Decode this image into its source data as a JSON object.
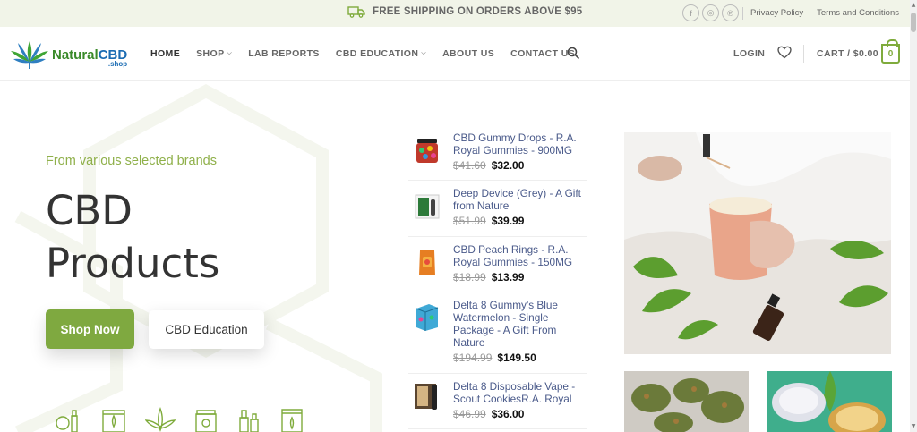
{
  "topbar": {
    "shipping_text": "FREE SHIPPING ON ORDERS ABOVE $95",
    "social": [
      {
        "icon": "facebook-icon",
        "glyph": "f"
      },
      {
        "icon": "instagram-icon",
        "glyph": "◎"
      },
      {
        "icon": "pinterest-icon",
        "glyph": "℗"
      }
    ],
    "links": [
      "Privacy Policy",
      "Terms and Conditions"
    ]
  },
  "header": {
    "logo": {
      "natural": "Natural",
      "cbd": "CBD",
      "shop": ".shop"
    },
    "nav": [
      {
        "label": "HOME",
        "active": true,
        "dropdown": false
      },
      {
        "label": "SHOP",
        "active": false,
        "dropdown": true
      },
      {
        "label": "LAB REPORTS",
        "active": false,
        "dropdown": false
      },
      {
        "label": "CBD EDUCATION",
        "active": false,
        "dropdown": true
      },
      {
        "label": "ABOUT US",
        "active": false,
        "dropdown": false
      },
      {
        "label": "CONTACT US",
        "active": false,
        "dropdown": false
      }
    ],
    "login_label": "LOGIN",
    "cart_label": "CART / $0.00",
    "cart_count": "0"
  },
  "hero": {
    "tagline": "From various selected brands",
    "title_line1": "CBD",
    "title_line2": "Products",
    "primary_button": "Shop Now",
    "secondary_button": "CBD Education"
  },
  "products": [
    {
      "name": "CBD Gummy Drops - R.A. Royal Gummies - 900MG",
      "old_price": "$41.60",
      "price": "$32.00",
      "thumb_color": "#c0392b"
    },
    {
      "name": "Deep Device (Grey) - A Gift from Nature",
      "old_price": "$51.99",
      "price": "$39.99",
      "thumb_color": "#444444"
    },
    {
      "name": "CBD Peach Rings - R.A. Royal Gummies - 150MG",
      "old_price": "$18.99",
      "price": "$13.99",
      "thumb_color": "#e67e22"
    },
    {
      "name": "Delta 8 Gummy's Blue Watermelon - Single Package - A Gift From Nature",
      "old_price": "$194.99",
      "price": "$149.50",
      "thumb_color": "#3fa9d6"
    },
    {
      "name": "Delta 8 Disposable Vape - Scout CookiesR.A. Royal",
      "old_price": "$46.99",
      "price": "$36.00",
      "thumb_color": "#5a4530"
    }
  ],
  "colors": {
    "accent": "#7fa940",
    "product_link": "#4a5a8a",
    "topbar_bg": "#f1f4e8"
  }
}
